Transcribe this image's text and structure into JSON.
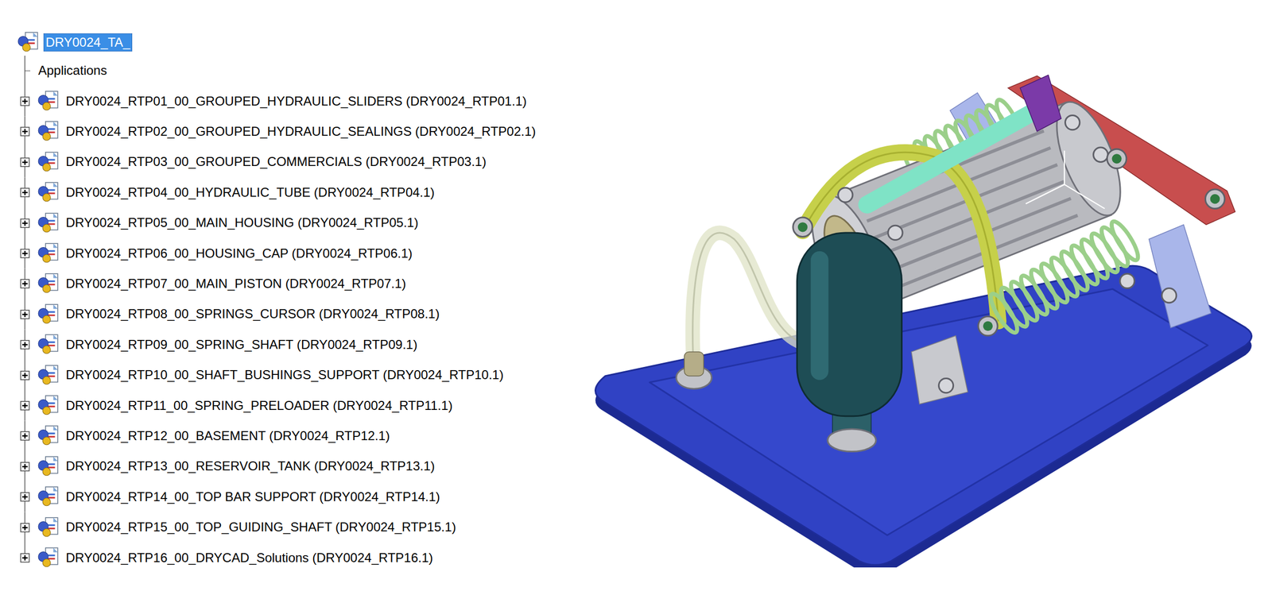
{
  "tree": {
    "root": {
      "label": "DRY0024_TA_",
      "selected": true
    },
    "applications": {
      "label": "Applications",
      "selected": false
    },
    "items": [
      {
        "label": "DRY0024_RTP01_00_GROUPED_HYDRAULIC_SLIDERS (DRY0024_RTP01.1)",
        "expanded": false,
        "selected": false
      },
      {
        "label": "DRY0024_RTP02_00_GROUPED_HYDRAULIC_SEALINGS (DRY0024_RTP02.1)",
        "expanded": false,
        "selected": false
      },
      {
        "label": "DRY0024_RTP03_00_GROUPED_COMMERCIALS (DRY0024_RTP03.1)",
        "expanded": false,
        "selected": false
      },
      {
        "label": "DRY0024_RTP04_00_HYDRAULIC_TUBE (DRY0024_RTP04.1)",
        "expanded": false,
        "selected": false
      },
      {
        "label": "DRY0024_RTP05_00_MAIN_HOUSING (DRY0024_RTP05.1)",
        "expanded": false,
        "selected": false
      },
      {
        "label": "DRY0024_RTP06_00_HOUSING_CAP (DRY0024_RTP06.1)",
        "expanded": false,
        "selected": false
      },
      {
        "label": "DRY0024_RTP07_00_MAIN_PISTON (DRY0024_RTP07.1)",
        "expanded": false,
        "selected": false
      },
      {
        "label": "DRY0024_RTP08_00_SPRINGS_CURSOR (DRY0024_RTP08.1)",
        "expanded": false,
        "selected": false
      },
      {
        "label": "DRY0024_RTP09_00_SPRING_SHAFT (DRY0024_RTP09.1)",
        "expanded": false,
        "selected": false
      },
      {
        "label": "DRY0024_RTP10_00_SHAFT_BUSHINGS_SUPPORT (DRY0024_RTP10.1)",
        "expanded": false,
        "selected": false
      },
      {
        "label": "DRY0024_RTP11_00_SPRING_PRELOADER (DRY0024_RTP11.1)",
        "expanded": false,
        "selected": false
      },
      {
        "label": "DRY0024_RTP12_00_BASEMENT (DRY0024_RTP12.1)",
        "expanded": false,
        "selected": false
      },
      {
        "label": "DRY0024_RTP13_00_RESERVOIR_TANK (DRY0024_RTP13.1)",
        "expanded": false,
        "selected": false
      },
      {
        "label": "DRY0024_RTP14_00_TOP BAR SUPPORT (DRY0024_RTP14.1)",
        "expanded": false,
        "selected": false
      },
      {
        "label": "DRY0024_RTP15_00_TOP_GUIDING_SHAFT (DRY0024_RTP15.1)",
        "expanded": false,
        "selected": false
      },
      {
        "label": "DRY0024_RTP16_00_DRYCAD_Solutions (DRY0024_RTP16.1)",
        "expanded": false,
        "selected": false
      }
    ]
  }
}
